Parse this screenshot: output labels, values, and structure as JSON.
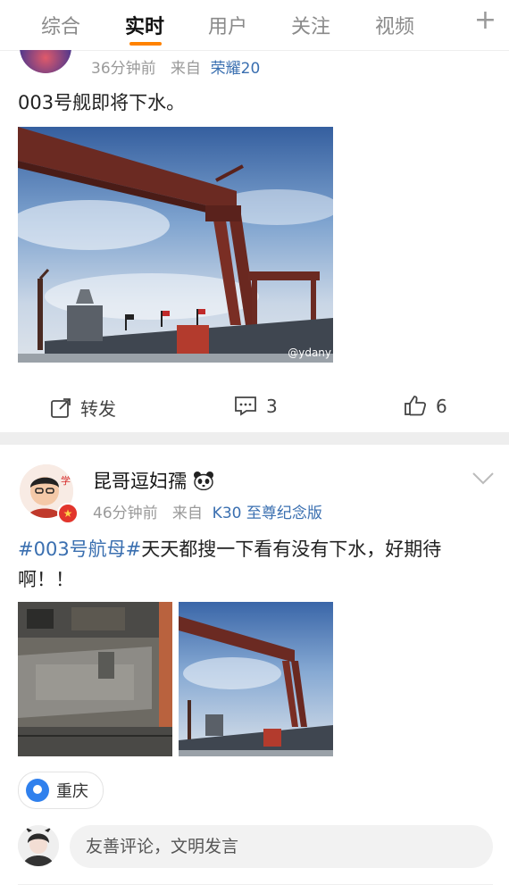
{
  "tabs": [
    {
      "label": "综合"
    },
    {
      "label": "实时"
    },
    {
      "label": "用户"
    },
    {
      "label": "关注"
    },
    {
      "label": "视频"
    }
  ],
  "active_tab_index": 1,
  "add_tab_icon": "plus-icon",
  "accent_color": "#ff8200",
  "link_color": "#3a6fb0",
  "post1": {
    "time": "36分钟前",
    "from_label": "来自",
    "source": "荣耀20",
    "text": "003号舰即将下水。",
    "image_watermark": "@ydany",
    "actions": {
      "repost_label": "转发",
      "comment_count": "3",
      "like_count": "6"
    }
  },
  "post2": {
    "username": "昆哥逗妇孺",
    "username_emoji": "panda-icon",
    "time": "46分钟前",
    "from_label": "来自",
    "source": "K30 至尊纪念版",
    "topic": "#003号航母#",
    "text": "天天都搜一下看有没有下水，好期待啊！！",
    "location": "重庆"
  },
  "comment_placeholder": "友善评论，文明发言"
}
